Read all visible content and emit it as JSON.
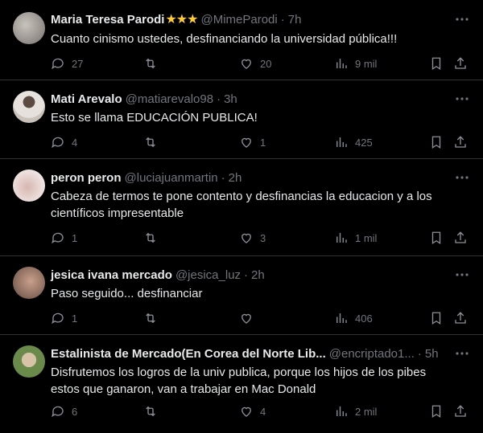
{
  "tweets": [
    {
      "name": "Maria Teresa Parodi",
      "stars": "★★★",
      "handle": "@MimeParodi",
      "time": "7h",
      "text": "Cuanto cinismo ustedes, desfinanciando la universidad pública!!!",
      "replies": "27",
      "retweets": "",
      "likes": "20",
      "views": "9 mil"
    },
    {
      "name": "Mati Arevalo",
      "handle": "@matiarevalo98",
      "time": "3h",
      "text": "Esto se llama EDUCACIÓN PUBLICA!",
      "replies": "4",
      "retweets": "",
      "likes": "1",
      "views": "425"
    },
    {
      "name": "peron peron",
      "handle": "@luciajuanmartin",
      "time": "2h",
      "text_line1": "Cabeza de termos te pone contento y desfinancias la educacion y a los",
      "text_line2": "científicos impresentable",
      "replies": "1",
      "retweets": "",
      "likes": "3",
      "views": "1 mil"
    },
    {
      "name": "jesica ivana mercado",
      "handle": "@jesica_luz",
      "time": "2h",
      "text": "Paso seguido... desfinanciar",
      "replies": "1",
      "retweets": "",
      "likes": "",
      "views": "406"
    },
    {
      "name": "Estalinista de Mercado(En Corea del Norte Lib...",
      "handle": "@encriptado1...",
      "time": "5h",
      "text_line1": "Disfrutemos los logros de la univ publica, porque los hijos de los  pibes",
      "text_line2": "estos que ganaron, van a trabajar en Mac Donald",
      "replies": "6",
      "retweets": "",
      "likes": "4",
      "views": "2 mil"
    }
  ],
  "ui": {
    "more_glyph": "•••",
    "dot": "·"
  }
}
